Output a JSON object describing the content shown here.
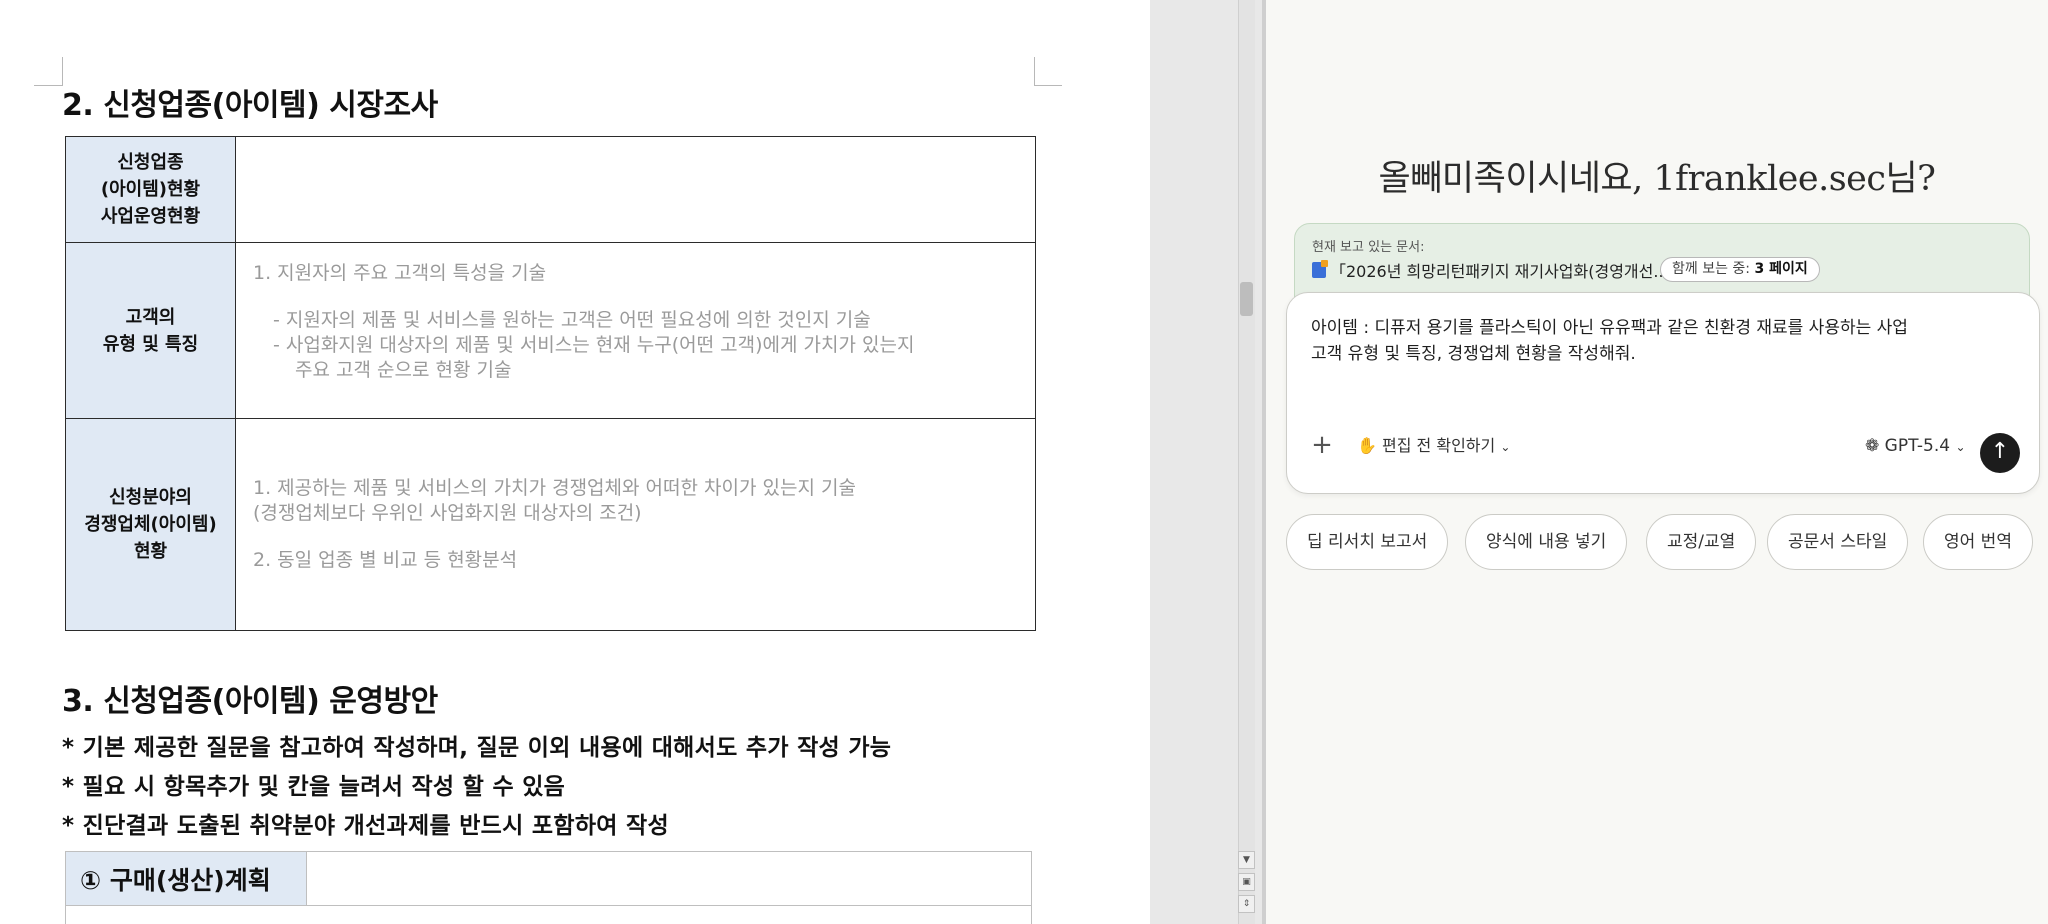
{
  "document": {
    "section2_heading": "2. 신청업종(아이템) 시장조사",
    "rows": [
      {
        "label_lines": [
          "신청업종",
          "(아이템)현황",
          "사업운영현황"
        ],
        "content": []
      },
      {
        "label_lines": [
          "고객의",
          "유형 및 특징"
        ],
        "content": [
          "1. 지원자의 주요 고객의 특성을 기술",
          "",
          "- 지원자의 제품 및 서비스를 원하는 고객은 어떤 필요성에 의한 것인지 기술",
          "- 사업화지원 대상자의 제품 및 서비스는 현재 누구(어떤 고객)에게 가치가 있는지",
          "주요 고객 순으로 현황 기술"
        ]
      },
      {
        "label_lines": [
          "신청분야의",
          "경쟁업체(아이템)",
          "현황"
        ],
        "content": [
          "1. 제공하는 제품 및 서비스의 가치가 경쟁업체와 어떠한 차이가 있는지 기술",
          "(경쟁업체보다 우위인 사업화지원 대상자의 조건)",
          "",
          "2. 동일 업종 별 비교 등 현황분석"
        ]
      }
    ],
    "section3_heading": "3. 신청업종(아이템) 운영방안",
    "notes": [
      "* 기본 제공한 질문을 참고하여 작성하며, 질문 이외 내용에 대해서도 추가 작성 가능",
      "* 필요 시 항목추가 및 칸을 늘려서 작성 할 수 있음",
      "* 진단결과 도출된 취약분야 개선과제를 반드시 포함하여 작성"
    ],
    "subtable_label": "① 구매(생산)계획"
  },
  "assistant": {
    "greeting": "올빼미족이시네요, 1franklee.sec님?",
    "context_label": "현재 보고 있는 문서:",
    "doc_title": "「2026년 희망리턴패키지 재기사업화(경영개선...",
    "pages_prefix": "함께 보는 중:",
    "pages_value": "3 페이지",
    "input_lines": [
      "아이템 : 디퓨저 용기를 플라스틱이 아닌 유유팩과 같은 친환경 재료를 사용하는 사업",
      "고객 유형 및 특징, 경쟁업체 현황을 작성해줘."
    ],
    "mode_label": "편집 전 확인하기",
    "model_label": "GPT-5.4",
    "chips": [
      "딥 리서치 보고서",
      "양식에 내용 넣기",
      "교정/교열",
      "공문서 스타일",
      "영어 번역"
    ]
  },
  "icons": {
    "plus": "plus-icon",
    "hand": "hand-icon",
    "chevron": "chevron-down-icon",
    "model": "openai-logo-icon",
    "send": "arrow-up-icon"
  },
  "colors": {
    "label_bg": "#e0e9f4",
    "context_bg": "#e6efe5",
    "send_bg": "#1c1c1c"
  }
}
